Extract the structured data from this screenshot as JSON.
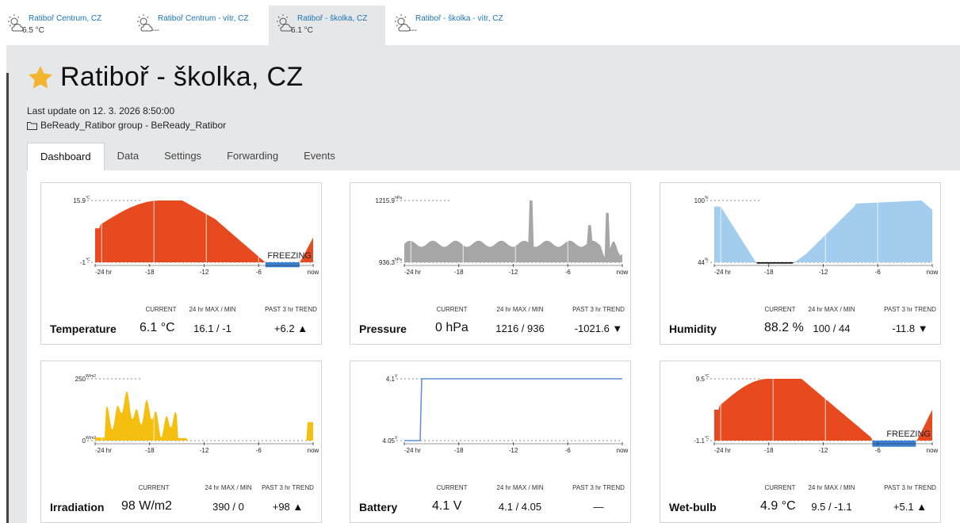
{
  "stations": [
    {
      "name": "Ratiboř Centrum, CZ",
      "value": "6.5 °C",
      "active": false
    },
    {
      "name": "Ratiboř Centrum - vítr, CZ",
      "value": "---",
      "active": false
    },
    {
      "name": "Ratiboř - školka, CZ",
      "value": "6.1 °C",
      "active": true
    },
    {
      "name": "Ratiboř - školka - vítr, CZ",
      "value": "---",
      "active": false
    }
  ],
  "station": {
    "title": "Ratiboř - školka, CZ",
    "last_update": "Last update on 12. 3. 2026 8:50:00",
    "group": "BeReady_Ratibor group - BeReady_Ratibor"
  },
  "tabs": [
    "Dashboard",
    "Data",
    "Settings",
    "Forwarding",
    "Events"
  ],
  "stat_heads": {
    "current": "CURRENT",
    "maxmin": "24 hr MAX / MIN",
    "trend": "PAST 3 hr TREND"
  },
  "colors": {
    "hot": "#e84a1f",
    "cold": "#3b7fd0",
    "gray": "#a6a6a6",
    "humidity": "#a3cdee",
    "irradiation": "#f5bf0f",
    "battery": "#5b8fd6",
    "link": "#1a73b8",
    "star": "#f3b530"
  },
  "cards": [
    {
      "label": "Temperature",
      "current": "6.1 °C",
      "maxmin": "16.1 / -1",
      "trend": "+6.2 ▲",
      "top_label": "15.9",
      "top_unit": "°C",
      "bottom_label": "-1",
      "bottom_unit": "°C",
      "annotation": "FREEZING",
      "x_ticks": [
        "-24 hr",
        "-18",
        "-12",
        "-6",
        "now"
      ]
    },
    {
      "label": "Pressure",
      "current": "0 hPa",
      "maxmin": "1216 / 936",
      "trend": "-1021.6 ▼",
      "top_label": "1215.9",
      "top_unit": "hPa",
      "bottom_label": "936.3",
      "bottom_unit": "hPa",
      "x_ticks": [
        "-24 hr",
        "-18",
        "-12",
        "-6",
        "now"
      ]
    },
    {
      "label": "Humidity",
      "current": "88.2 %",
      "maxmin": "100 / 44",
      "trend": "-11.8 ▼",
      "top_label": "100",
      "top_unit": "%",
      "bottom_label": "44",
      "bottom_unit": "%",
      "x_ticks": [
        "-24 hr",
        "-18",
        "-12",
        "-6",
        "now"
      ]
    },
    {
      "label": "Irradiation",
      "current": "98 W/m2",
      "maxmin": "390 / 0",
      "trend": "+98 ▲",
      "top_label": "250",
      "top_unit": "W/m2",
      "bottom_label": "0",
      "bottom_unit": "W/m2",
      "x_ticks": [
        "-24 hr",
        "-18",
        "-12",
        "-6",
        "now"
      ]
    },
    {
      "label": "Battery",
      "current": "4.1 V",
      "maxmin": "4.1 / 4.05",
      "trend": "—",
      "top_label": "4.1",
      "top_unit": "V",
      "bottom_label": "4.05",
      "bottom_unit": "V",
      "x_ticks": [
        "-24 hr",
        "-18",
        "-12",
        "-6",
        "now"
      ]
    },
    {
      "label": "Wet-bulb",
      "current": "4.9 °C",
      "maxmin": "9.5 / -1.1",
      "trend": "+5.1 ▲",
      "top_label": "9.5",
      "top_unit": "°C",
      "bottom_label": "-1.1",
      "bottom_unit": "°C",
      "annotation": "FREEZING",
      "x_ticks": [
        "-24 hr",
        "-18",
        "-12",
        "-6",
        "now"
      ]
    }
  ]
}
